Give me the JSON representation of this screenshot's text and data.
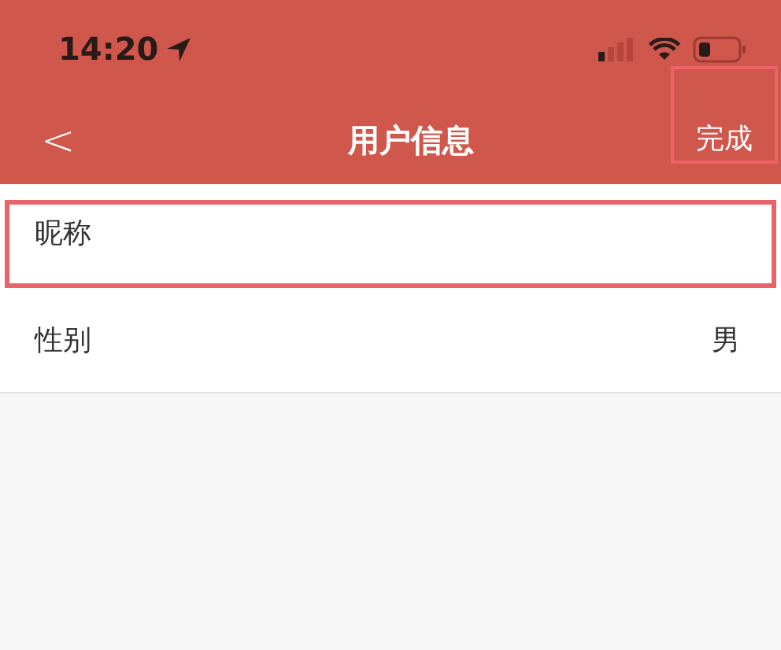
{
  "status_bar": {
    "time": "14:20"
  },
  "nav_bar": {
    "back": "<",
    "title": "用户信息",
    "action": {
      "label": "完成",
      "highlighted": true
    }
  },
  "rows": [
    {
      "label": "昵称",
      "highlighted": true
    },
    {
      "label": "性别",
      "value": "男",
      "highlighted": false
    }
  ]
}
